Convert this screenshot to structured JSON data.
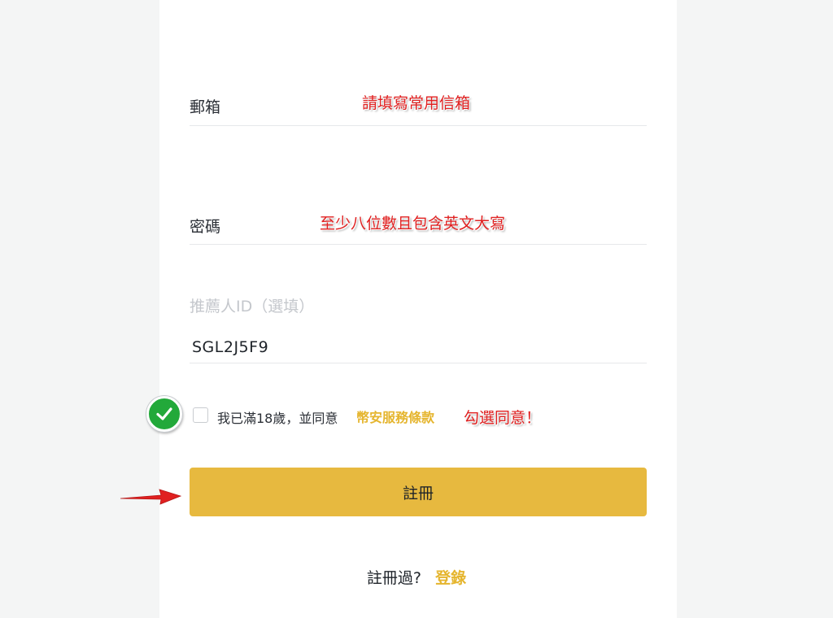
{
  "form": {
    "email_label": "郵箱",
    "email_annotation": "請填寫常用信箱",
    "password_label": "密碼",
    "password_annotation": "至少八位數且包含英文大寫",
    "referral_label": "推薦人ID（選填）",
    "referral_value": "SGL2J5F9",
    "terms_text": "我已滿18歲，並同意",
    "terms_link": "幣安服務條款",
    "terms_annotation": "勾選同意！",
    "register_button": "註冊",
    "login_prompt": "註冊過?",
    "login_link": "登錄"
  },
  "icons": {
    "check_badge": "check-circle-icon",
    "arrow": "red-arrow-icon"
  },
  "colors": {
    "accent": "#e7b93f",
    "link": "#e5b52e",
    "annotation": "#e02020",
    "badge": "#22a93a"
  }
}
